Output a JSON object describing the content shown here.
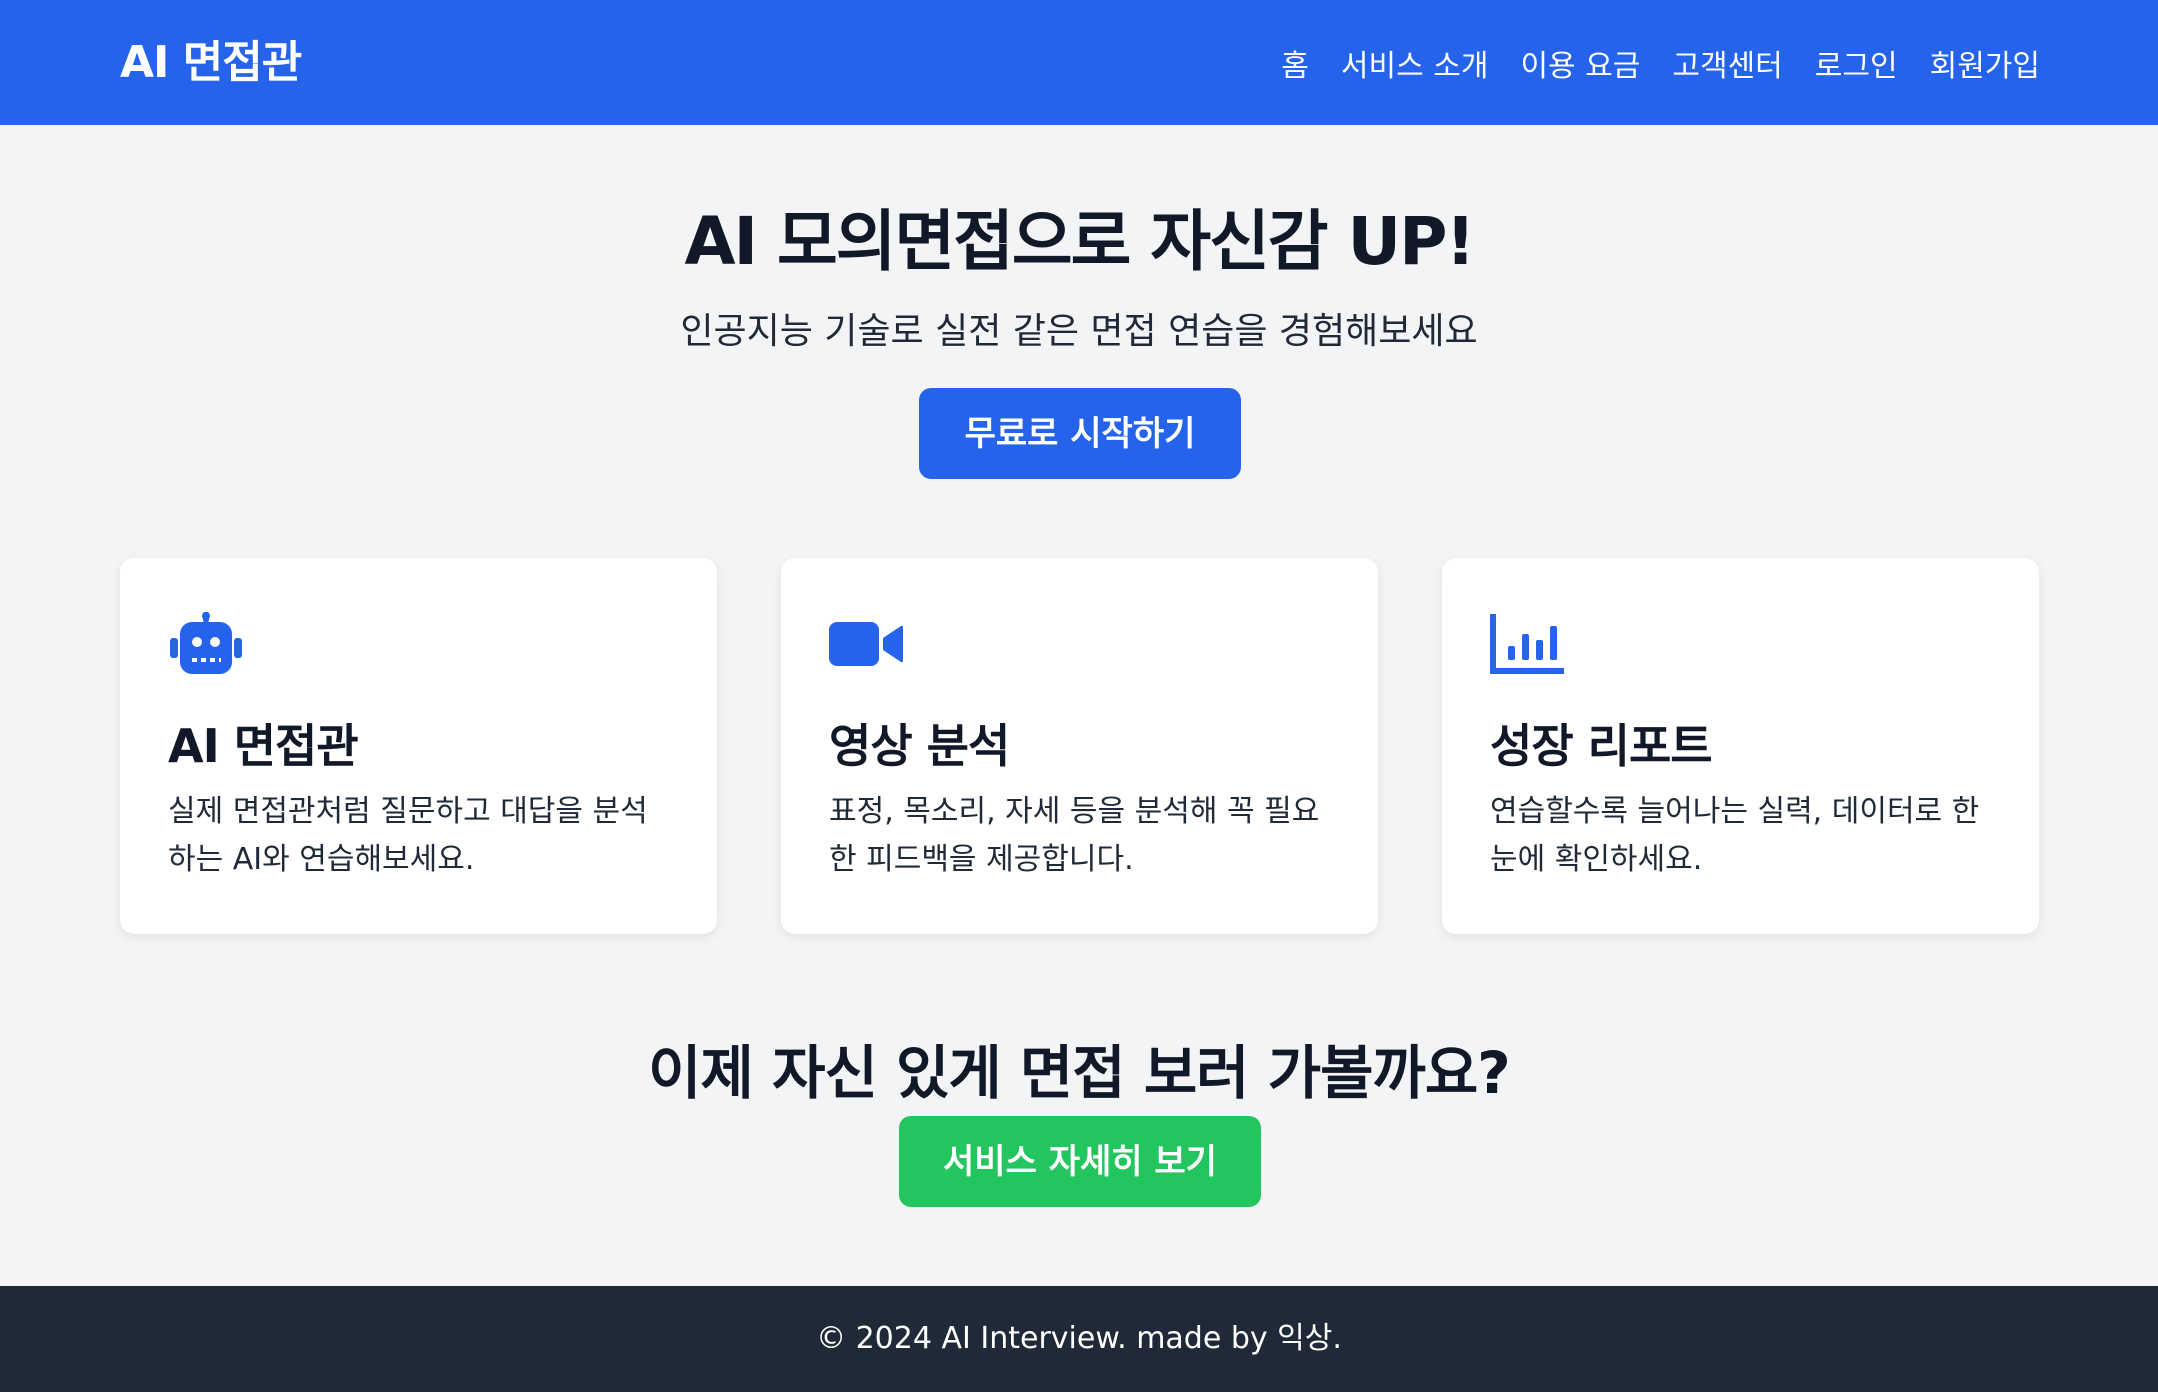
{
  "header": {
    "logo": "AI 면접관",
    "nav": [
      {
        "label": "홈"
      },
      {
        "label": "서비스 소개"
      },
      {
        "label": "이용 요금"
      },
      {
        "label": "고객센터"
      },
      {
        "label": "로그인"
      },
      {
        "label": "회원가입"
      }
    ]
  },
  "hero": {
    "title": "AI 모의면접으로 자신감 UP!",
    "subtitle": "인공지능 기술로 실전 같은 면접 연습을 경험해보세요",
    "cta_label": "무료로 시작하기"
  },
  "features": [
    {
      "icon": "robot-icon",
      "title": "AI 면접관",
      "desc_line1": "실제 면접관처럼 질문하고 대답을 분석",
      "desc_line2": "하는 AI와 연습해보세요."
    },
    {
      "icon": "video-camera-icon",
      "title": "영상 분석",
      "desc_line1": "표정, 목소리, 자세 등을 분석해 꼭 필요",
      "desc_line2": "한 피드백을 제공합니다."
    },
    {
      "icon": "bar-chart-icon",
      "title": "성장 리포트",
      "desc_line1": "연습할수록 늘어나는 실력, 데이터로 한",
      "desc_line2": "눈에 확인하세요."
    }
  ],
  "cta": {
    "title": "이제 자신 있게 면접 보러 가볼까요?",
    "button_label": "서비스 자세히 보기"
  },
  "footer": {
    "text": "© 2024 AI Interview. made by 익상."
  },
  "colors": {
    "primary": "#2563eb",
    "success": "#22c55e",
    "footer_bg": "#1f2937",
    "page_bg": "#f3f4f6"
  }
}
